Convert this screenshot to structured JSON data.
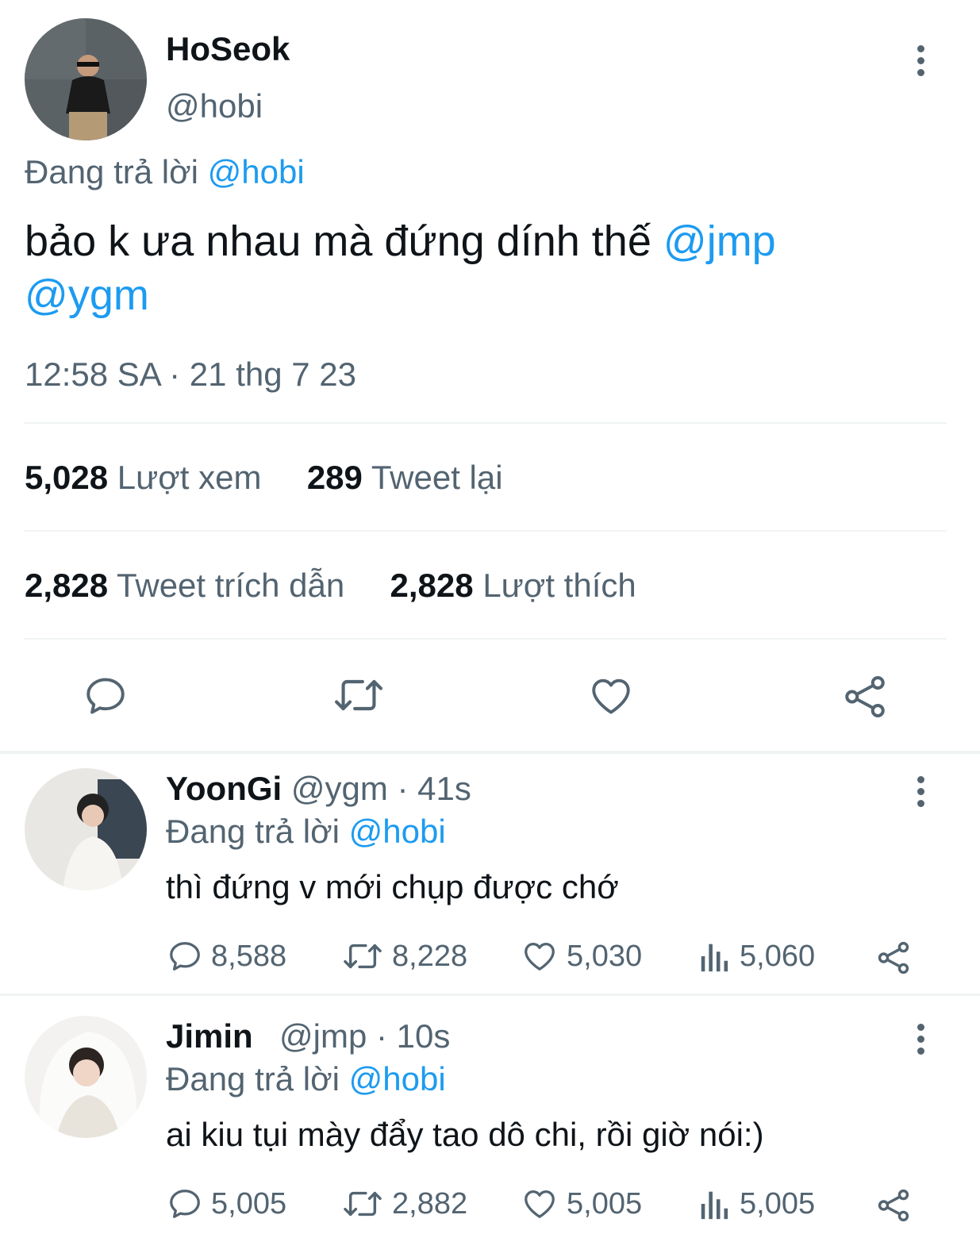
{
  "main_tweet": {
    "display_name": "HoSeok",
    "handle": "@hobi",
    "reply_prefix": "Đang trả lời",
    "reply_to": "@hobi",
    "text": "bảo k ưa nhau mà đứng dính thế",
    "mention1": "@jmp",
    "mention2": "@ygm",
    "timestamp": "12:58 SA · 21 thg 7 23",
    "views_count": "5,028",
    "views_label": "Lượt xem",
    "retweets_count": "289",
    "retweets_label": "Tweet lại",
    "quotes_count": "2,828",
    "quotes_label": "Tweet trích dẫn",
    "likes_count": "2,828",
    "likes_label": "Lượt thích"
  },
  "replies": [
    {
      "display_name": "YoonGi",
      "handle": "@ygm",
      "time": "· 41s",
      "reply_prefix": "Đang trả lời",
      "reply_to": "@hobi",
      "text": "thì đứng v mới chụp được chớ",
      "replies": "8,588",
      "retweets": "8,228",
      "likes": "5,030",
      "views": "5,060"
    },
    {
      "display_name": "Jimin",
      "handle": "@jmp",
      "time": "· 10s",
      "reply_prefix": "Đang trả lời",
      "reply_to": "@hobi",
      "text": "ai kiu tụi mày đẩy tao dô chi, rồi giờ nói:)",
      "replies": "5,005",
      "retweets": "2,882",
      "likes": "5,005",
      "views": "5,005"
    }
  ],
  "icons": {
    "reply": "speech-bubble-icon",
    "retweet": "retweet-icon",
    "like": "heart-icon",
    "views": "bar-chart-icon",
    "share": "share-icon",
    "more": "more-vertical-icon"
  },
  "colors": {
    "link": "#1d9bf0",
    "muted": "#536471",
    "text": "#0f1419"
  }
}
